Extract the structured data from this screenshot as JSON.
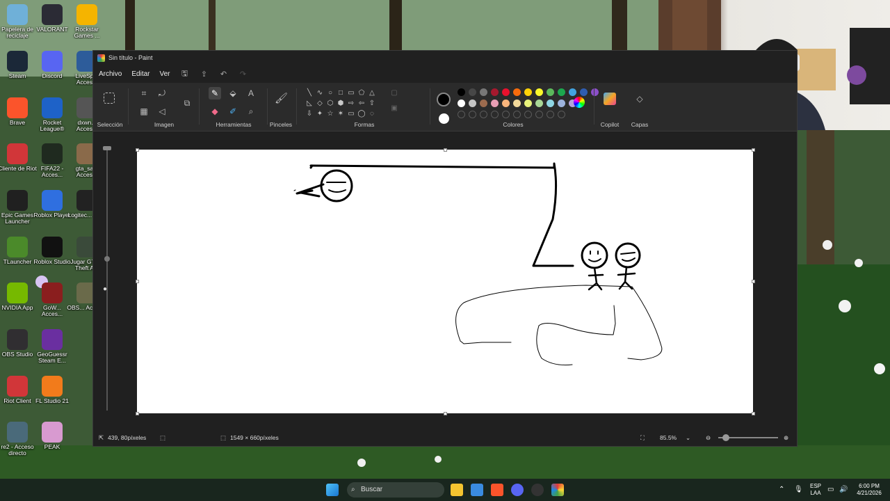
{
  "desktop_icons": [
    {
      "label": "Papelera de reciclaje",
      "icon": "recycle-bin-icon",
      "color": "#6fb0d8"
    },
    {
      "label": "VALORANT",
      "icon": "valorant-icon",
      "color": "#2b2b35"
    },
    {
      "label": "Rockstar Games ...",
      "icon": "rockstar-icon",
      "color": "#f5b400"
    },
    {
      "label": "Steam",
      "icon": "steam-icon",
      "color": "#1b2838"
    },
    {
      "label": "Discord",
      "icon": "discord-icon",
      "color": "#5865f2"
    },
    {
      "label": "LiveSp... Acces...",
      "icon": "livesplit-icon",
      "color": "#2d5c9a"
    },
    {
      "label": "Brave",
      "icon": "brave-icon",
      "color": "#fb542b"
    },
    {
      "label": "Rocket League®",
      "icon": "rocket-league-icon",
      "color": "#1e62c8"
    },
    {
      "label": "dxwn... Acces...",
      "icon": "shortcut-icon",
      "color": "#555"
    },
    {
      "label": "Cliente de Riot",
      "icon": "riot-client-icon",
      "color": "#d13639"
    },
    {
      "label": "FIFA22 - Acces...",
      "icon": "fifa-icon",
      "color": "#1f2a1f"
    },
    {
      "label": "gta_sa... Acces...",
      "icon": "gta-sa-icon",
      "color": "#8a6a4a"
    },
    {
      "label": "Epic Games Launcher",
      "icon": "epic-games-icon",
      "color": "#202020"
    },
    {
      "label": "Roblox Player",
      "icon": "roblox-player-icon",
      "color": "#2f6fe0"
    },
    {
      "label": "Logitec... HUB",
      "icon": "logitech-icon",
      "color": "#222"
    },
    {
      "label": "TLauncher",
      "icon": "tlauncher-icon",
      "color": "#4b8a2a"
    },
    {
      "label": "Roblox Studio",
      "icon": "roblox-studio-icon",
      "color": "#111"
    },
    {
      "label": "Jugar GTA... Theft A...",
      "icon": "gta-v-icon",
      "color": "#3a4a3a"
    },
    {
      "label": "NVIDIA App",
      "icon": "nvidia-icon",
      "color": "#76b900"
    },
    {
      "label": "GoW... Acces...",
      "icon": "gow-icon",
      "color": "#8a1e1e"
    },
    {
      "label": "OBS... Acces...",
      "icon": "shortcut2-icon",
      "color": "#6a6a4a"
    },
    {
      "label": "OBS Studio",
      "icon": "obs-icon",
      "color": "#302e31"
    },
    {
      "label": "GeoGuessr Steam E...",
      "icon": "geoguessr-icon",
      "color": "#6a2fa0"
    },
    {
      "label": "Riot Client",
      "icon": "riot-client2-icon",
      "color": "#d13639"
    },
    {
      "label": "FL Studio 21",
      "icon": "fl-studio-icon",
      "color": "#f27b1b"
    },
    {
      "label": "re2 - Acceso directo",
      "icon": "re2-icon",
      "color": "#4a6a7a"
    },
    {
      "label": "PEAK",
      "icon": "peak-icon",
      "color": "#d89ad0"
    }
  ],
  "paint": {
    "title": "Sin título - Paint",
    "menu": {
      "file": "Archivo",
      "edit": "Editar",
      "view": "Ver"
    },
    "groups": {
      "selection": "Selección",
      "image": "Imagen",
      "tools": "Herramientas",
      "brushes": "Pinceles",
      "shapes": "Formas",
      "colors": "Colores",
      "copilot": "Copilot",
      "layers": "Capas"
    },
    "palette_row1": [
      "#000000",
      "#474747",
      "#777777",
      "#a6192e",
      "#e8112d",
      "#f76b0c",
      "#fdd207",
      "#f9f72b",
      "#5cb85c",
      "#1ca74e",
      "#41a3e0",
      "#2f5db0",
      "#8b4fc9"
    ],
    "palette_row2": [
      "#ffffff",
      "#c4c4c4",
      "#9c6b4e",
      "#e89eb4",
      "#f8b47b",
      "#f2d89a",
      "#e8f27a",
      "#a9d796",
      "#8fd6e4",
      "#9db3dd",
      "#b4a3d8"
    ],
    "primary_color": "#000000",
    "secondary_color": "#ffffff",
    "status": {
      "cursor_pos": "439, 80píxeles",
      "canvas_size": "1549 × 660píxeles",
      "zoom": "85.5%"
    }
  },
  "taskbar": {
    "search_placeholder": "Buscar",
    "lang_top": "ESP",
    "lang_bottom": "LAA",
    "time": "6:00 PM",
    "date": "4/21/2026"
  }
}
